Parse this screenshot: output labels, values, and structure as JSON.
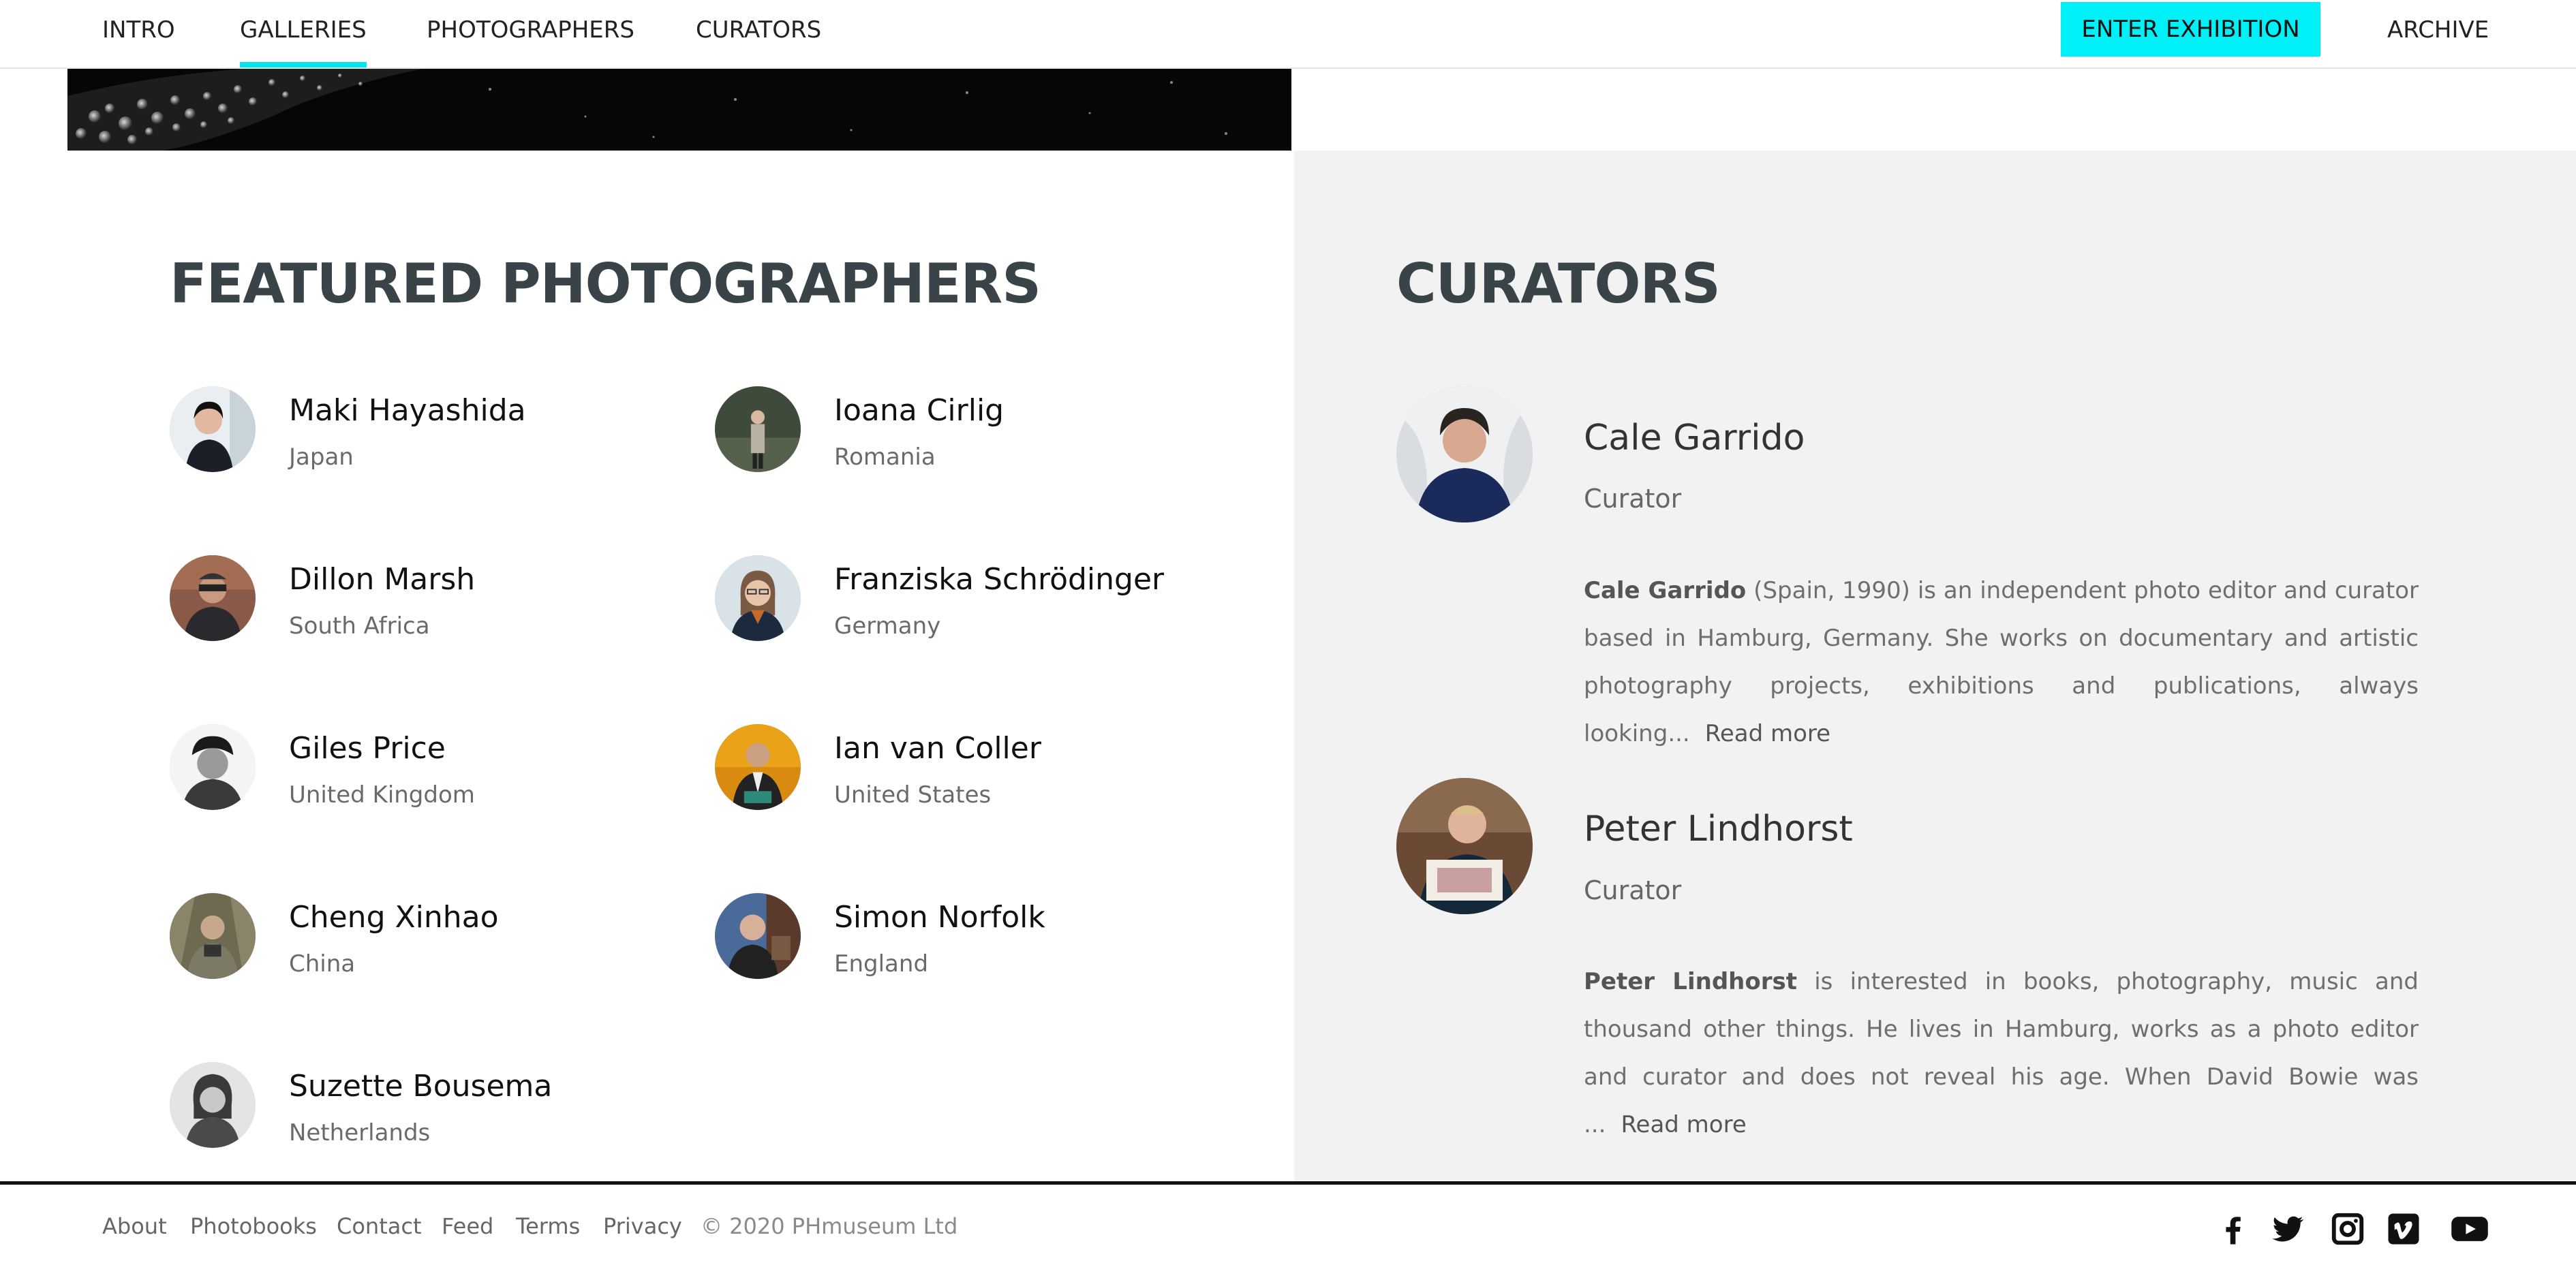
{
  "nav": {
    "items": [
      {
        "label": "INTRO"
      },
      {
        "label": "GALLERIES"
      },
      {
        "label": "PHOTOGRAPHERS"
      },
      {
        "label": "CURATORS"
      }
    ],
    "active": "GALLERIES",
    "cta_label": "ENTER EXHIBITION",
    "archive_label": "ARCHIVE",
    "accent_color": "#00f0f8"
  },
  "photographers": {
    "title": "FEATURED PHOTOGRAPHERS",
    "items": [
      {
        "name": "Maki Hayashida",
        "country": "Japan"
      },
      {
        "name": "Ioana Cirlig",
        "country": "Romania"
      },
      {
        "name": "Dillon Marsh",
        "country": "South Africa"
      },
      {
        "name": "Franziska Schrödinger",
        "country": "Germany"
      },
      {
        "name": "Giles Price",
        "country": "United Kingdom"
      },
      {
        "name": "Ian van Coller",
        "country": "United States"
      },
      {
        "name": "Cheng Xinhao",
        "country": "China"
      },
      {
        "name": "Simon Norfolk",
        "country": "England"
      },
      {
        "name": "Suzette Bousema",
        "country": "Netherlands"
      }
    ]
  },
  "curators": {
    "title": "CURATORS",
    "items": [
      {
        "name": "Cale Garrido",
        "role": "Curator",
        "bio_name": "Cale Garrido",
        "bio_text": " (Spain, 1990) is an independent photo editor and curator based in Hamburg, Germany. She works on documentary and artistic photography projects, exhibitions and publications, always looking...",
        "read_more": "Read more"
      },
      {
        "name": "Peter Lindhorst",
        "role": "Curator",
        "bio_name": "Peter Lindhorst",
        "bio_text": " is interested in books, photography, music and thousand other things. He lives in Hamburg, works as a photo editor and curator and does not reveal his age. When David Bowie was ...",
        "read_more": "Read more"
      }
    ]
  },
  "footer": {
    "links": [
      "About",
      "Photobooks",
      "Contact",
      "Feed",
      "Terms",
      "Privacy"
    ],
    "copyright": "© 2020 PHmuseum Ltd",
    "social_icons": [
      "facebook-icon",
      "twitter-icon",
      "instagram-icon",
      "vimeo-icon",
      "youtube-icon"
    ]
  }
}
